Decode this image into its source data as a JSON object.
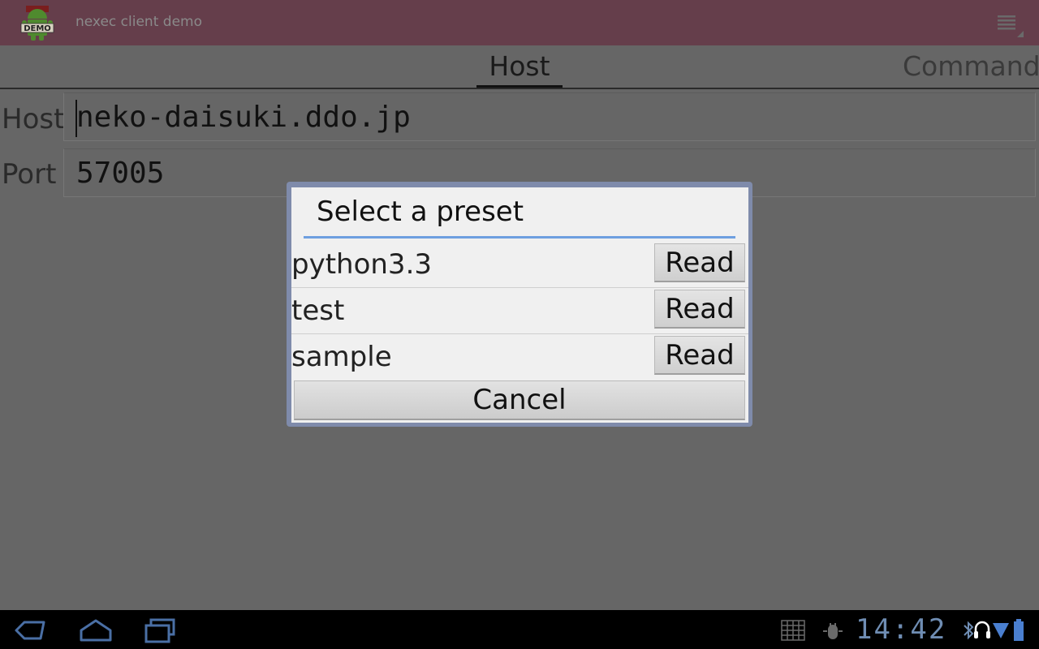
{
  "app": {
    "title": "nexec client demo",
    "icon_label": "DEMO"
  },
  "tabs": [
    {
      "label": "Host",
      "selected": true
    },
    {
      "label": "Command",
      "selected": false
    }
  ],
  "form": {
    "host_label": "Host",
    "host_value": "neko-daisuki.ddo.jp",
    "port_label": "Port",
    "port_value": "57005"
  },
  "dialog": {
    "title": "Select a preset",
    "presets": [
      {
        "name": "python3.3",
        "button": "Read"
      },
      {
        "name": "test",
        "button": "Read"
      },
      {
        "name": "sample",
        "button": "Read"
      }
    ],
    "cancel_label": "Cancel"
  },
  "system_bar": {
    "clock": "14:42"
  },
  "colors": {
    "action_bar": "#653e4b",
    "dialog_accent": "#6e9fe0",
    "clock": "#6f8db3"
  }
}
